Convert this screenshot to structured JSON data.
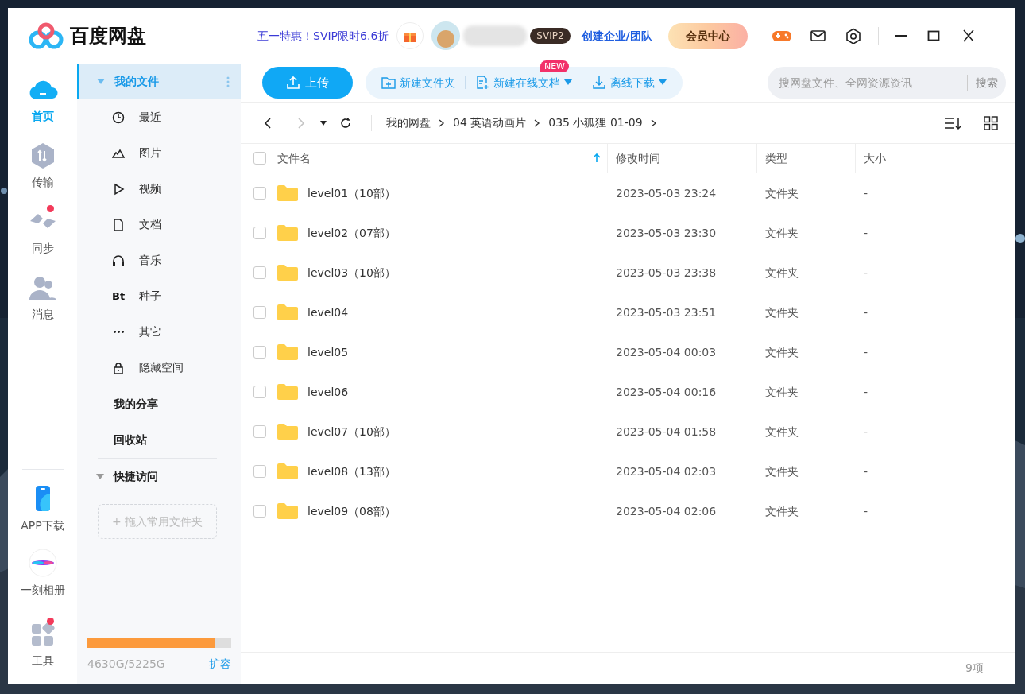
{
  "app": {
    "title": "百度网盘"
  },
  "header": {
    "promo": "五一特惠！SVIP限时6.6折",
    "vip_badge": "SVIP2",
    "team_link": "创建企业/团队",
    "member_button": "会员中心"
  },
  "rail": {
    "items": [
      {
        "label": "首页",
        "selected": true,
        "badge": false
      },
      {
        "label": "传输",
        "selected": false,
        "badge": false
      },
      {
        "label": "同步",
        "selected": false,
        "badge": true
      },
      {
        "label": "消息",
        "selected": false,
        "badge": false
      }
    ],
    "bottom": [
      {
        "label": "APP下载",
        "badge": false
      },
      {
        "label": "一刻相册",
        "badge": false
      },
      {
        "label": "工具",
        "badge": true
      }
    ]
  },
  "nav": {
    "my_files": {
      "label": "我的文件",
      "expanded": true,
      "selected": true
    },
    "categories": [
      {
        "label": "最近",
        "selected": false
      },
      {
        "label": "图片",
        "selected": false
      },
      {
        "label": "视频",
        "selected": false
      },
      {
        "label": "文档",
        "selected": false
      },
      {
        "label": "音乐",
        "selected": false
      },
      {
        "label": "种子",
        "selected": false,
        "icon_text": "Bt"
      },
      {
        "label": "其它",
        "selected": false
      },
      {
        "label": "隐藏空间",
        "selected": false
      }
    ],
    "links": [
      "我的分享",
      "回收站"
    ],
    "quick_access": {
      "label": "快捷访问",
      "expanded": true,
      "drop_hint": "+ 拖入常用文件夹"
    },
    "storage": {
      "level": 0.886,
      "reading": "4630G/5225G",
      "expand": "扩容"
    }
  },
  "toolbar": {
    "upload": "上传",
    "actions": [
      {
        "label": "新建文件夹",
        "dropdown": false
      },
      {
        "label": "新建在线文档",
        "dropdown": true,
        "badge": "NEW"
      },
      {
        "label": "离线下载",
        "dropdown": true
      }
    ],
    "search": {
      "placeholder": "搜网盘文件、全网资源资讯",
      "button": "搜索"
    }
  },
  "path_bar": {
    "back_disabled": false,
    "forward_disabled": true,
    "breadcrumb": [
      "我的网盘",
      "04 英语动画片",
      "035 小狐狸 01-09"
    ]
  },
  "table": {
    "all_checked": false,
    "columns": [
      {
        "label": "文件名",
        "sorted": true
      },
      {
        "label": "修改时间",
        "sorted": false
      },
      {
        "label": "类型",
        "sorted": false
      },
      {
        "label": "大小",
        "sorted": false
      }
    ],
    "rows": [
      {
        "name": "level01（10部）",
        "modified": "2023-05-03 23:24",
        "type": "文件夹",
        "size": "-",
        "checked": false
      },
      {
        "name": "level02（07部）",
        "modified": "2023-05-03 23:30",
        "type": "文件夹",
        "size": "-",
        "checked": false
      },
      {
        "name": "level03（10部）",
        "modified": "2023-05-03 23:38",
        "type": "文件夹",
        "size": "-",
        "checked": false
      },
      {
        "name": "level04",
        "modified": "2023-05-03 23:51",
        "type": "文件夹",
        "size": "-",
        "checked": false
      },
      {
        "name": "level05",
        "modified": "2023-05-04 00:03",
        "type": "文件夹",
        "size": "-",
        "checked": false
      },
      {
        "name": "level06",
        "modified": "2023-05-04 00:16",
        "type": "文件夹",
        "size": "-",
        "checked": false
      },
      {
        "name": "level07（10部）",
        "modified": "2023-05-04 01:58",
        "type": "文件夹",
        "size": "-",
        "checked": false
      },
      {
        "name": "level08（13部）",
        "modified": "2023-05-04 02:03",
        "type": "文件夹",
        "size": "-",
        "checked": false
      },
      {
        "name": "level09（08部）",
        "modified": "2023-05-04 02:06",
        "type": "文件夹",
        "size": "-",
        "checked": false
      }
    ]
  },
  "status_bar": {
    "count": "9项"
  }
}
